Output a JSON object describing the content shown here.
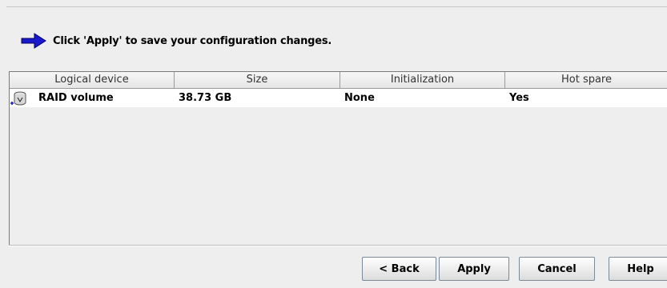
{
  "message": {
    "text": "Click 'Apply' to save your configuration changes.",
    "icon": "right-arrow-icon",
    "icon_color": "#1a1acc"
  },
  "table": {
    "headers": [
      "Logical device",
      "Size",
      "Initialization",
      "Hot spare"
    ],
    "rows": [
      {
        "icon": "disk-icon",
        "device": "RAID volume",
        "size": "38.73 GB",
        "initialization": "None",
        "hot_spare": "Yes"
      }
    ]
  },
  "buttons": {
    "back": "< Back",
    "apply": "Apply",
    "cancel": "Cancel",
    "help": "Help"
  }
}
